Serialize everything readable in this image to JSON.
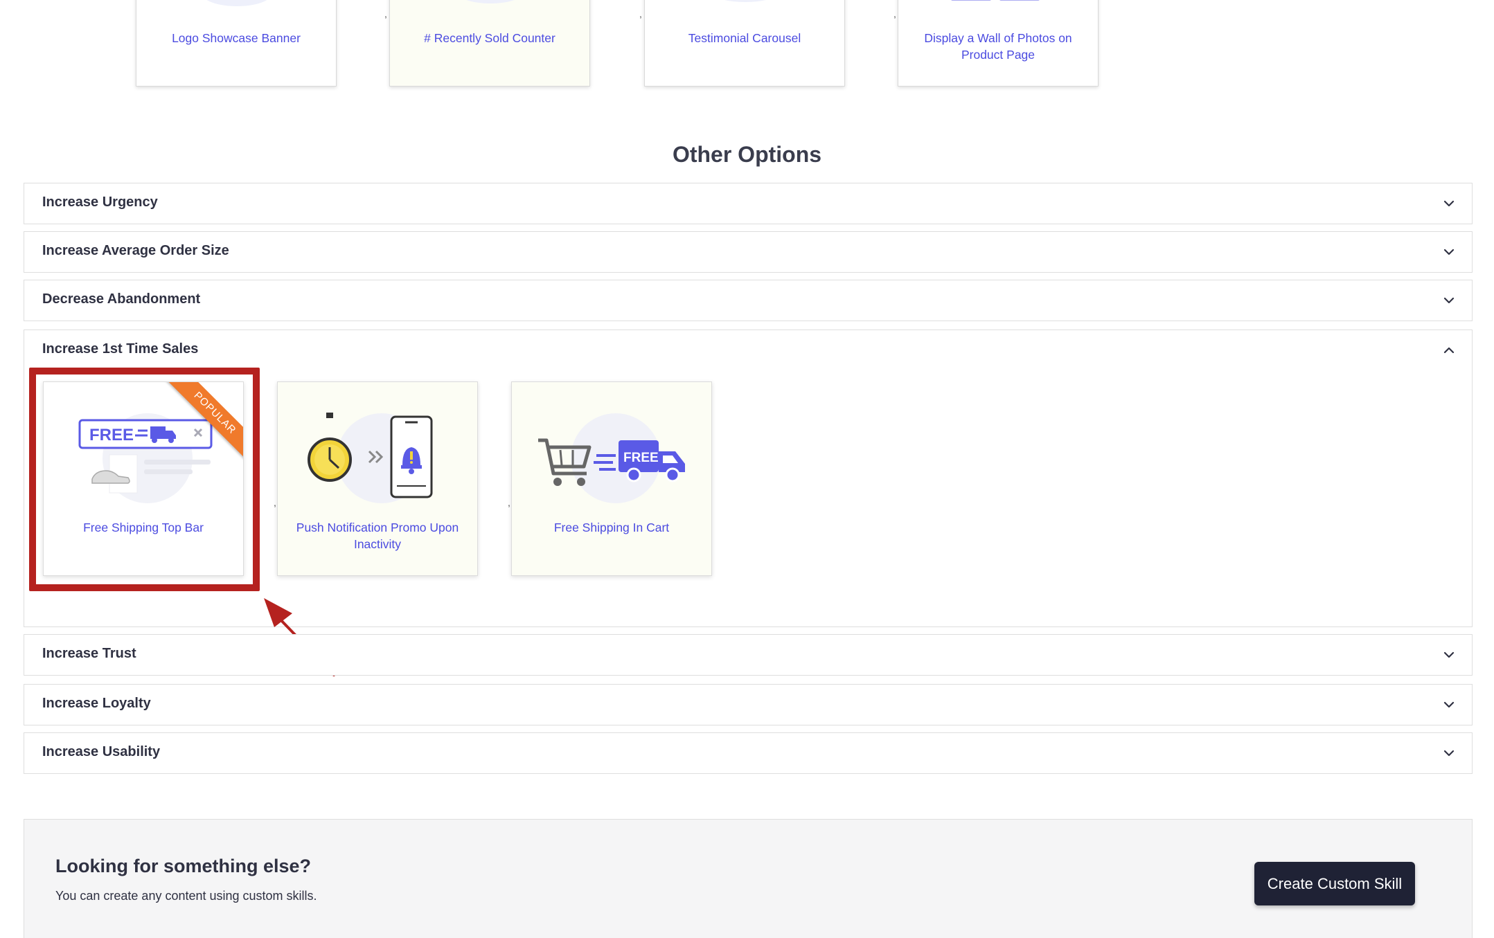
{
  "top_cards": [
    {
      "label": "Logo Showcase Banner"
    },
    {
      "label": "# Recently Sold Counter"
    },
    {
      "label": "Testimonial Carousel"
    },
    {
      "label": "Display a Wall of Photos on Product Page"
    }
  ],
  "section_title": "Other Options",
  "accordion": {
    "collapsed_before": [
      {
        "title": "Increase Urgency"
      },
      {
        "title": "Increase Average Order Size"
      },
      {
        "title": "Decrease Abandonment"
      }
    ],
    "expanded": {
      "title": "Increase 1st Time Sales",
      "cards": [
        {
          "label": "Free Shipping Top Bar",
          "badge": "POPULAR",
          "art_text": "FREE"
        },
        {
          "label": "Push Notification Promo Upon Inactivity"
        },
        {
          "label": "Free Shipping In Cart",
          "art_text": "FREE"
        }
      ]
    },
    "collapsed_after": [
      {
        "title": "Increase Trust"
      },
      {
        "title": "Increase Loyalty"
      },
      {
        "title": "Increase Usability"
      }
    ]
  },
  "bottom_panel": {
    "title": "Looking for something else?",
    "subtitle": "You can create any content using custom skills.",
    "button_label": "Create Custom Skill"
  },
  "colors": {
    "accent": "#4b4be0",
    "highlight": "#b5221f",
    "badge": "#f07a2b",
    "button": "#1f2235"
  }
}
